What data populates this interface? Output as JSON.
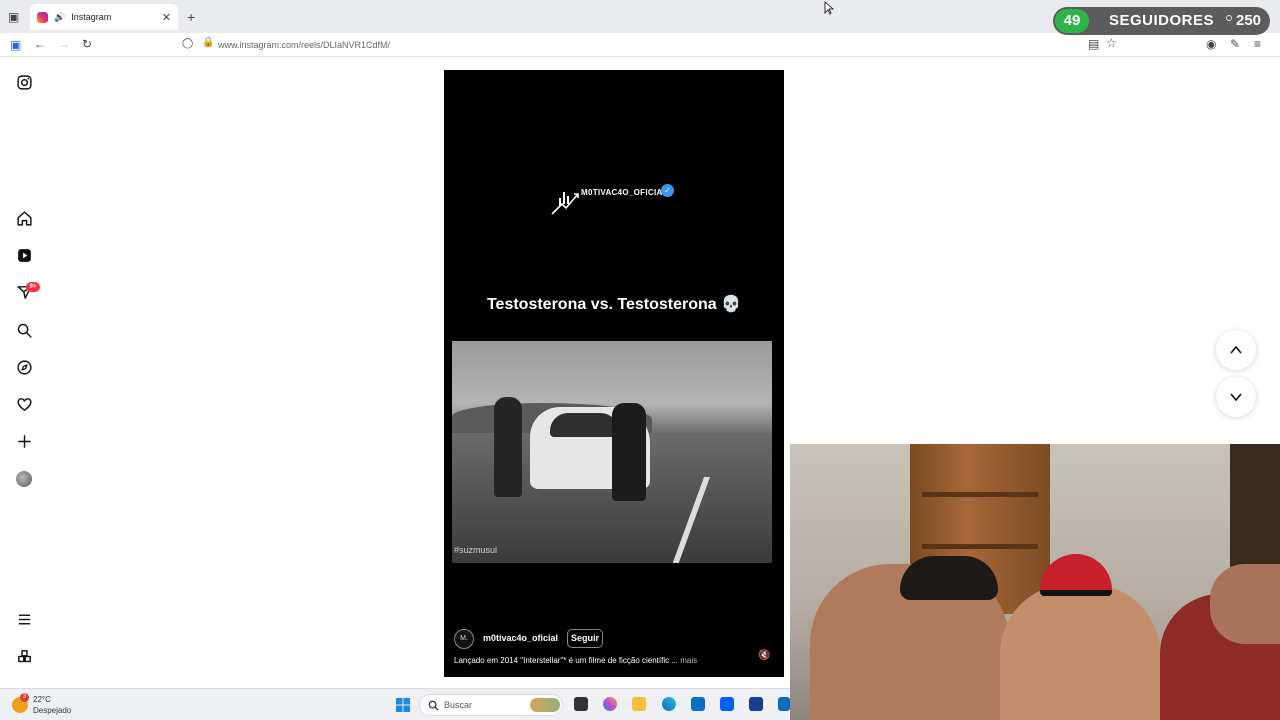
{
  "browser": {
    "tab_title": "Instagram",
    "url": "www.instagram.com/reels/DLIaNVR1CdfM/"
  },
  "followers_widget": {
    "count": "49",
    "label": "SEGUIDORES",
    "goal": "250",
    "colors": {
      "count_bg": "#2eb54a",
      "bar_bg": "#5c5c5c"
    }
  },
  "sidebar": {
    "icons": [
      "instagram-icon",
      "home-icon",
      "reels-icon",
      "messages-icon",
      "search-icon",
      "explore-icon",
      "heart-icon",
      "create-icon",
      "profile-avatar",
      "menu-icon",
      "more-apps-icon"
    ],
    "notification_badge": "9+"
  },
  "reel": {
    "brand_text": "M0TIVAC4O_OFICIAL",
    "title": "Testosterona vs. Testosterona 💀",
    "video_watermark": "#suzmusul",
    "account_initials": "M.",
    "account_name": "m0tivac4o_oficial",
    "follow_label": "Seguir",
    "caption": "Lançado em 2014 \"Interstellar\"* é um filme de ficção científic ...",
    "caption_more": "mais"
  },
  "taskbar": {
    "weather_temp": "22°C",
    "weather_condition": "Despejado",
    "weather_badge": "3",
    "search_placeholder": "Buscar"
  },
  "colors": {
    "accent_blue": "#3897f0",
    "badge_red": "#ff3040"
  }
}
